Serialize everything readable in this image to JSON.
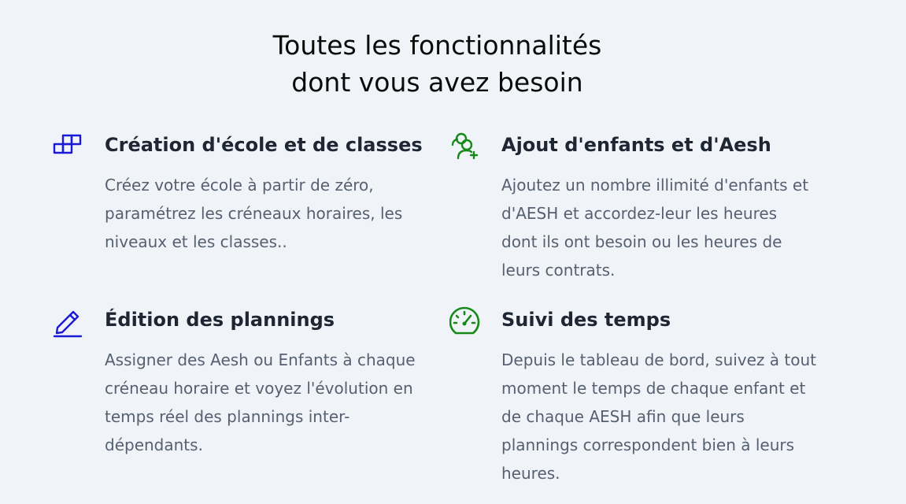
{
  "section": {
    "title_line1": "Toutes les fonctionnalités",
    "title_line2": "dont vous avez besoin"
  },
  "features": [
    {
      "icon": "blocks-icon",
      "icon_color": "#1a1ad6",
      "title": "Création d'école et de classes",
      "description": "Créez votre école à partir de zéro, paramétrez les créneaux horaires, les niveaux et les classes.."
    },
    {
      "icon": "user-add-icon",
      "icon_color": "#168a16",
      "title": "Ajout d'enfants et d'Aesh",
      "description": "Ajoutez un nombre illimité d'enfants et d'AESH et accordez-leur les heures dont ils ont besoin ou les heures de leurs contrats."
    },
    {
      "icon": "pencil-icon",
      "icon_color": "#1a1ad6",
      "title": "Édition des plannings",
      "description": "Assigner des Aesh ou Enfants à chaque créneau horaire et voyez l'évolution en temps réel des plannings inter-dépendants."
    },
    {
      "icon": "speedometer-icon",
      "icon_color": "#168a16",
      "title": "Suivi des temps",
      "description": "Depuis le tableau de bord, suivez à tout moment le temps de chaque enfant et de chaque AESH afin que leurs plannings correspondent bien à leurs heures."
    }
  ]
}
